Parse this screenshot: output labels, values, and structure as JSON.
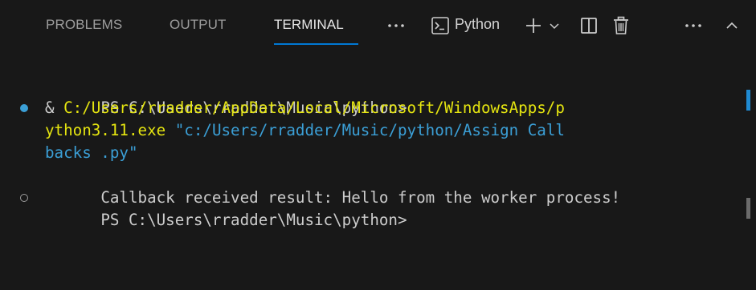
{
  "tabs": {
    "problems": "PROBLEMS",
    "output": "OUTPUT",
    "terminal": "TERMINAL"
  },
  "toolbar": {
    "terminal_profile_label": "Python",
    "icons": [
      "more-icon",
      "terminal-icon",
      "plus-icon",
      "chevron-down-icon",
      "split-icon",
      "trash-icon",
      "more-icon",
      "chevron-up-icon"
    ]
  },
  "terminal": {
    "line1": "PS C:\\Users\\rradder\\Music\\python>",
    "line2_prefix": "& ",
    "line2_path": "C:/Users/rradder/AppData/Local/Microsoft/WindowsApps/p",
    "line3_path": "ython3.11.exe",
    "line3_arg": "\"c:/Users/rradder/Music/python/Assign Call",
    "line4_arg": "backs .py\"",
    "line5": "Callback received result: Hello from the worker process!",
    "line6": "PS C:\\Users\\rradder\\Music\\python>"
  },
  "colors": {
    "background": "#181818",
    "accent": "#0078d4",
    "command_yellow": "#e5e510",
    "string_blue": "#3b9fd6"
  }
}
